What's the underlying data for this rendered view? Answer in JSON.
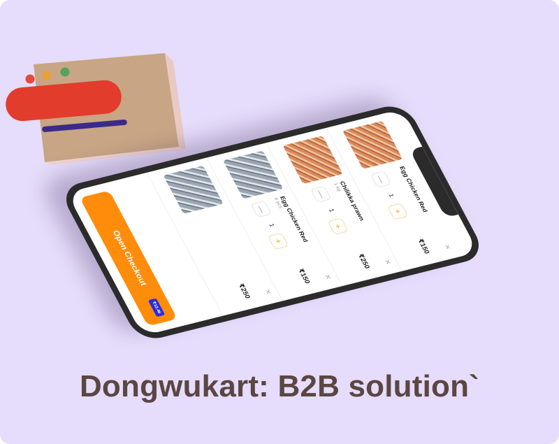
{
  "caption": "Dongwukart: B2B solution`",
  "cart": {
    "items": [
      {
        "name": "Egg Chicken Red",
        "subtitle": "",
        "quantity": "1",
        "price": "₹150",
        "image": "prawn"
      },
      {
        "name": "Chilikka prawn",
        "subtitle": "1 kg",
        "quantity": "1",
        "price": "₹250",
        "image": "prawn"
      },
      {
        "name": "Egg Chicken Red",
        "subtitle": "6 pcs",
        "quantity": "1",
        "price": "₹150",
        "image": "fish"
      },
      {
        "name": "",
        "subtitle": "",
        "quantity": "",
        "price": "₹250",
        "image": "fish"
      }
    ],
    "checkout_label": "Open Checkout",
    "checkout_badge": "₹12.46"
  },
  "icons": {
    "plus": "+",
    "minus": "—",
    "remove": "✕"
  },
  "colors": {
    "background": "#e6dcfb",
    "caption": "#5a4642",
    "accent": "#ff8c0a",
    "badge": "#2b2bdd"
  }
}
